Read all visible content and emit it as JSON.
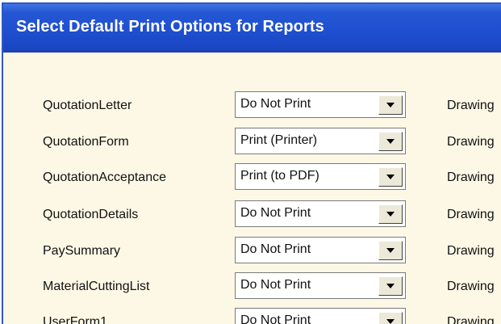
{
  "window": {
    "title": "Select Default Print Options for Reports"
  },
  "rows": [
    {
      "label": "QuotationLetter",
      "selected": "Do Not Print",
      "right_label": "Drawing"
    },
    {
      "label": "QuotationForm",
      "selected": "Print (Printer)",
      "right_label": "Drawing"
    },
    {
      "label": "QuotationAcceptance",
      "selected": "Print (to PDF)",
      "right_label": "Drawing"
    },
    {
      "label": "QuotationDetails",
      "selected": "Do Not Print",
      "right_label": "Drawing"
    },
    {
      "label": "PaySummary",
      "selected": "Do Not Print",
      "right_label": "Drawing"
    },
    {
      "label": "MaterialCuttingList",
      "selected": "Do Not Print",
      "right_label": "Drawing"
    },
    {
      "label": "UserForm1",
      "selected": "Do Not Print",
      "right_label": "Drawing"
    }
  ],
  "colors": {
    "titlebar": "#1f4fd0",
    "window_bg": "#fdf8e6"
  }
}
